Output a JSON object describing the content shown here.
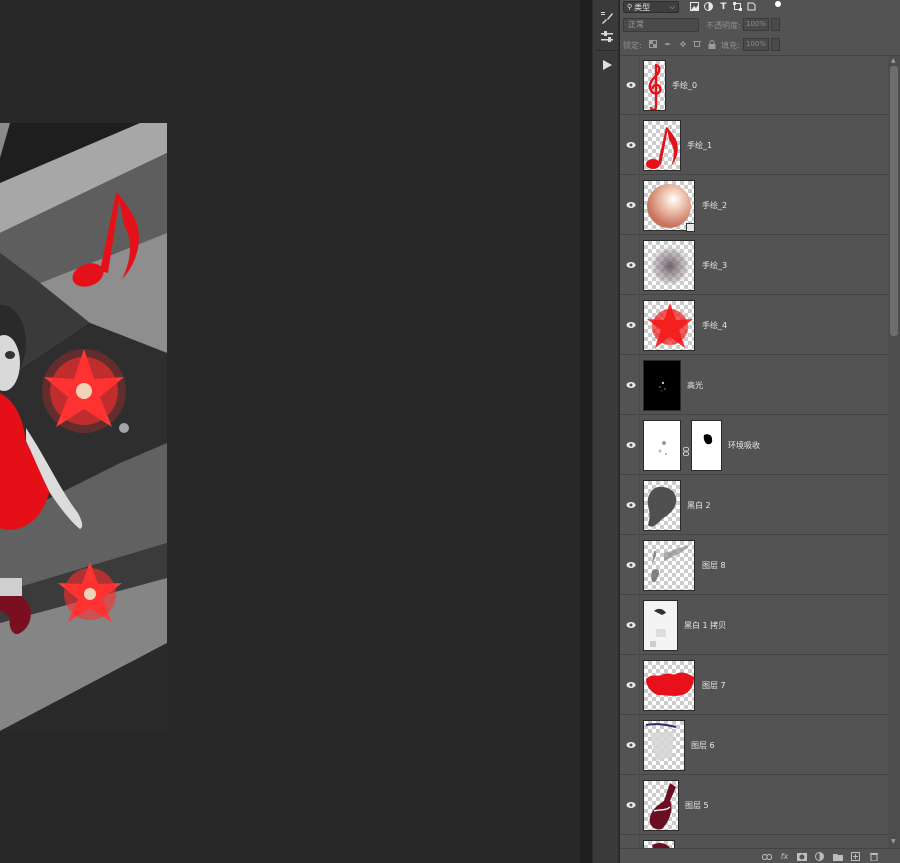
{
  "canvas": {
    "artwork_description_icon": "artwork-preview"
  },
  "tool_column": {
    "icons": [
      "brush-settings-icon",
      "adjustments-icon",
      "play-icon"
    ]
  },
  "layers_panel": {
    "filter": {
      "label": "类型",
      "icons": [
        "image-filter-icon",
        "adjustment-filter-icon",
        "type-filter-icon",
        "shape-filter-icon",
        "smart-object-filter-icon",
        "filter-toggle-icon"
      ]
    },
    "blend_mode": "正常",
    "opacity_label": "不透明度:",
    "opacity_value": "100%",
    "lock_label": "锁定:",
    "lock_icons": [
      "lock-transparent-icon",
      "lock-paint-icon",
      "lock-position-icon",
      "lock-artboard-icon",
      "lock-all-icon"
    ],
    "fill_label": "填充:",
    "fill_value": "100%",
    "layers": [
      {
        "name": "手绘_0",
        "thumb": "treble-clef"
      },
      {
        "name": "手绘_1",
        "thumb": "music-note"
      },
      {
        "name": "手绘_2",
        "thumb": "pearl"
      },
      {
        "name": "手绘_3",
        "thumb": "shadow-blur"
      },
      {
        "name": "手绘_4",
        "thumb": "red-flower"
      },
      {
        "name": "高光",
        "thumb": "black-highlight"
      },
      {
        "name": "环境吸收",
        "thumb": "white-mask"
      },
      {
        "name": "黑白 2",
        "thumb": "hair-silhouette"
      },
      {
        "name": "图层 8",
        "thumb": "gray-strokes"
      },
      {
        "name": "黑白 1 拷贝",
        "thumb": "light-mask"
      },
      {
        "name": "图层 7",
        "thumb": "red-skirt"
      },
      {
        "name": "图层 6",
        "thumb": "gray-figure"
      },
      {
        "name": "图层 5",
        "thumb": "dark-red-shoe"
      },
      {
        "name": "",
        "thumb": "partial"
      }
    ],
    "footer_icons": [
      "link-layers-icon",
      "fx-icon",
      "add-mask-icon",
      "adjustment-layer-icon",
      "group-folder-icon",
      "new-layer-icon",
      "trash-icon"
    ]
  },
  "colors": {
    "panel_bg": "#535353",
    "canvas_bg": "#282828",
    "accent_red": "#e8101a"
  }
}
